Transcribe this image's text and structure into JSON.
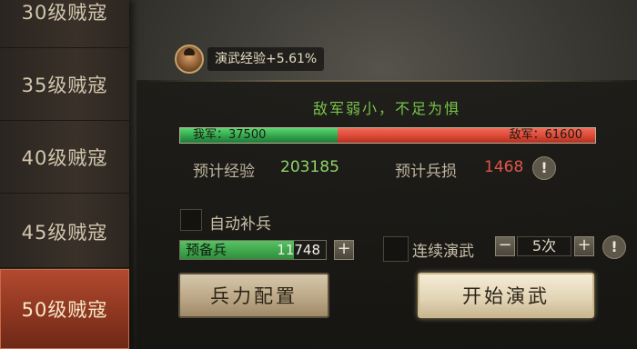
{
  "sidebar": {
    "items": [
      {
        "label": "30级贼寇"
      },
      {
        "label": "35级贼寇"
      },
      {
        "label": "40级贼寇"
      },
      {
        "label": "45级贼寇"
      },
      {
        "label": "50级贼寇",
        "active": true
      }
    ]
  },
  "exp_badge": {
    "text": "演武经验+5.61%"
  },
  "slogan": "敌军弱小，不足为惧",
  "strength": {
    "mine_label": "我军：37500",
    "enemy_label": "敌军：61600",
    "mine_value": 37500,
    "enemy_value": 61600,
    "mine_color": "#2ea04a",
    "enemy_color": "#d84634"
  },
  "stats": {
    "exp_label": "预计经验",
    "exp_value": "203185",
    "exp_color": "#8fd36a",
    "loss_label": "预计兵损",
    "loss_value": "1468",
    "loss_color": "#e0554a",
    "warn_glyph": "!"
  },
  "auto_supply": {
    "label": "自动补兵",
    "checked": false
  },
  "reserve": {
    "label": "预备兵",
    "value": "11748",
    "fill_fraction": 0.78,
    "plus": "+"
  },
  "continuous": {
    "label": "连续演武",
    "checked": false,
    "minus": "−",
    "count": "5次",
    "plus": "+",
    "warn_glyph": "!"
  },
  "buttons": {
    "config": "兵力配置",
    "start": "开始演武"
  }
}
